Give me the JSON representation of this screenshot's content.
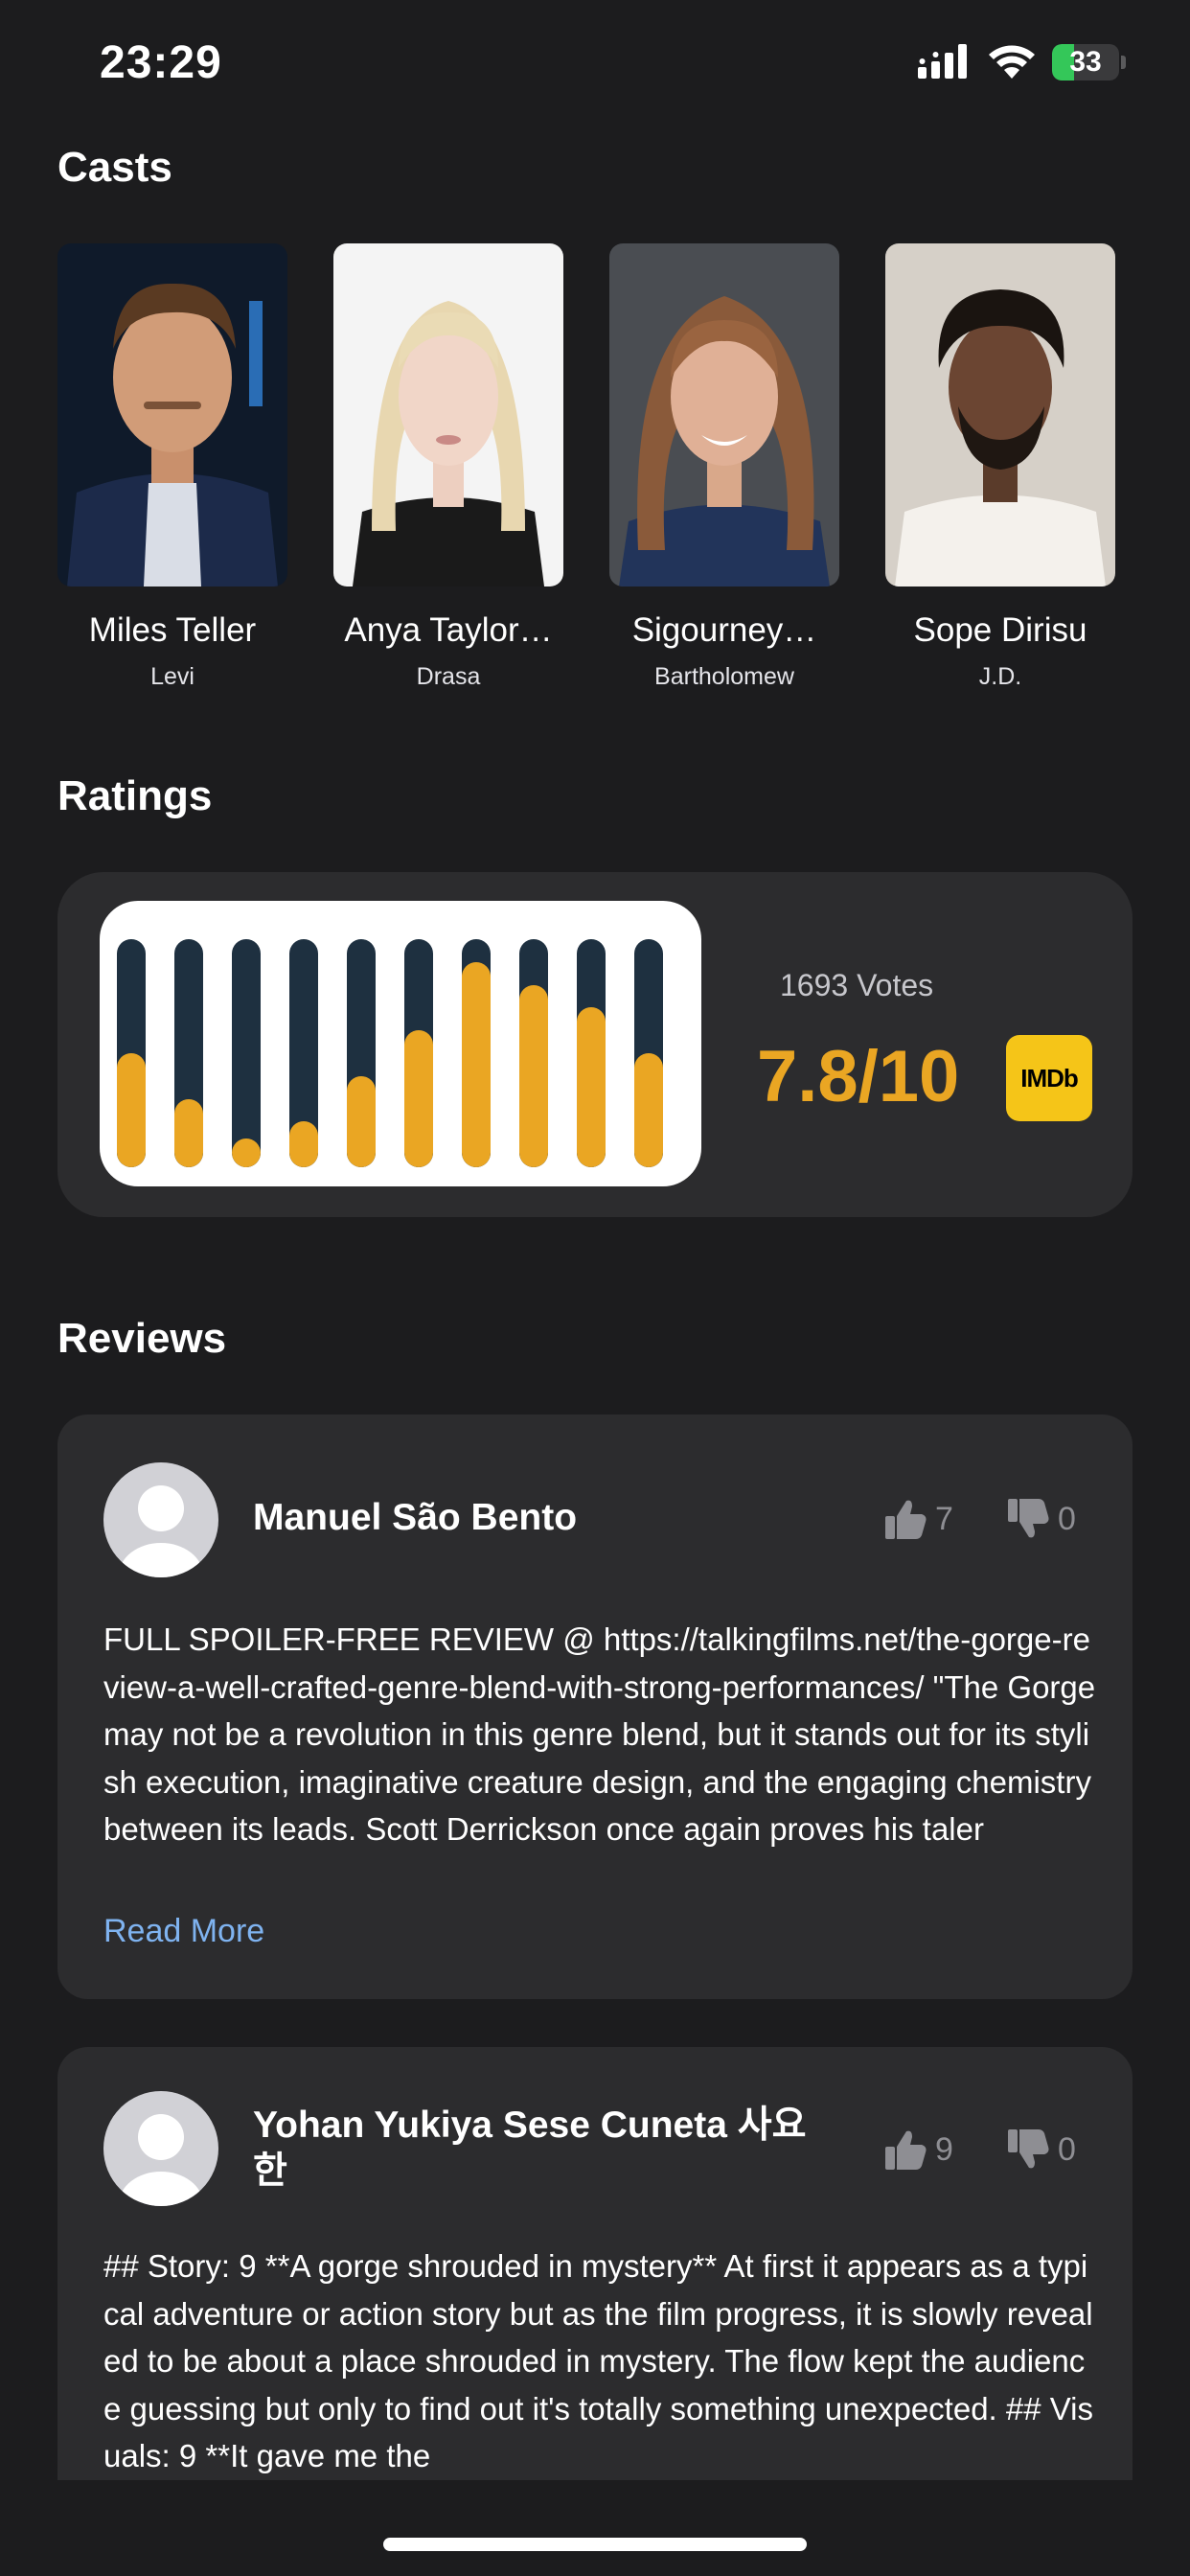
{
  "status_bar": {
    "time": "23:29",
    "battery": "33"
  },
  "casts": {
    "title": "Casts",
    "items": [
      {
        "name": "Miles Teller",
        "role": "Levi"
      },
      {
        "name": "Anya Taylor…",
        "role": "Drasa"
      },
      {
        "name": "Sigourney…",
        "role": "Bartholomew"
      },
      {
        "name": "Sope Dirisu",
        "role": "J.D."
      }
    ]
  },
  "ratings": {
    "title": "Ratings",
    "votes": "1693 Votes",
    "score": "7.8/10",
    "badge": "IMDb",
    "distribution": [
      0.5,
      0.3,
      0.1,
      0.2,
      0.4,
      0.6,
      0.9,
      0.8,
      0.7,
      0.5
    ]
  },
  "reviews": {
    "title": "Reviews",
    "items": [
      {
        "author": "Manuel São Bento",
        "likes": "7",
        "dislikes": "0",
        "text": "FULL SPOILER-FREE REVIEW @ https://talkingfilms.net/the-gorge-review-a-well-crafted-genre-blend-with-strong-performances/ \"The Gorge may not be a revolution in this genre blend, but it stands out for its stylish execution, imaginative creature design, and the engaging chemistry between its leads. Scott Derrickson once again proves his taler",
        "read_more": "Read More"
      },
      {
        "author": "Yohan Yukiya Sese Cuneta 사요한",
        "likes": "9",
        "dislikes": "0",
        "text": "## Story: 9 **A gorge shrouded in mystery** At first it appears as a typical adventure or action story but as the film progress, it is slowly revealed to be about a place shrouded in mystery. The flow kept the audience guessing but only to find out it's totally something unexpected. ## Visuals: 9 **It gave me the"
      }
    ]
  }
}
